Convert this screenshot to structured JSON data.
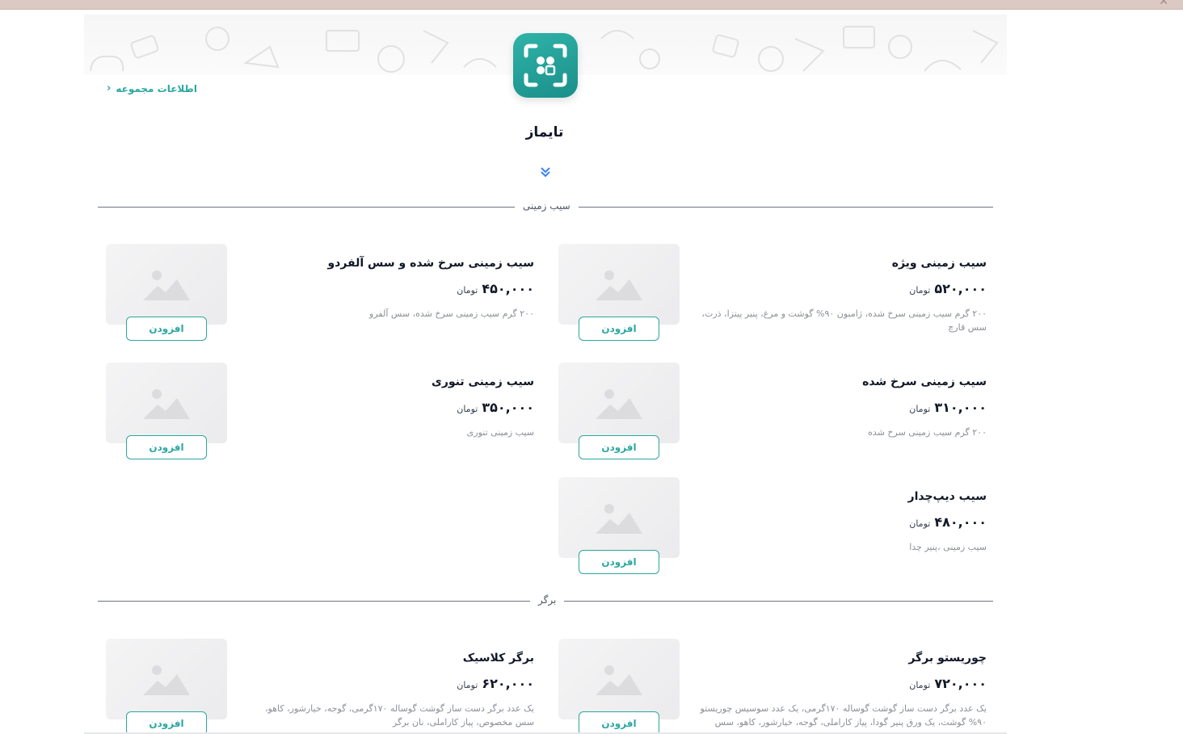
{
  "header": {
    "collection_info_link": "اطلاعات مجموعه",
    "restaurant_name": "تایماز"
  },
  "colors": {
    "accent": "#2ba7a0",
    "logo_gradient_start": "#2fb3a8",
    "logo_gradient_end": "#1b8f8a"
  },
  "sections": [
    {
      "title": "سیب زمینی",
      "items": [
        {
          "name": "سیب زمینی ویژه",
          "price": "۵۲۰,۰۰۰",
          "unit": "تومان",
          "desc": "۲۰۰ گرم سیب زمینی سرخ شده، ژامبون ۹۰% گوشت و مرغ، پنیر پیتزا، ذرت، سس قارچ",
          "button": "افزودن"
        },
        {
          "name": "سیب زمینی سرخ شده و سس آلفردو",
          "price": "۴۵۰,۰۰۰",
          "unit": "تومان",
          "desc": "۲۰۰ گرم سیب زمینی سرخ شده، سس آلفرو",
          "button": "افزودن"
        },
        {
          "name": "سیب زمینی سرخ شده",
          "price": "۳۱۰,۰۰۰",
          "unit": "تومان",
          "desc": "۲۰۰ گرم سیب زمینی سرخ شده",
          "button": "افزودن"
        },
        {
          "name": "سیب زمینی تنوری",
          "price": "۳۵۰,۰۰۰",
          "unit": "تومان",
          "desc": "سیب زمینی تنوری",
          "button": "افزودن"
        },
        {
          "name": "سیب دیپ‌چدار",
          "price": "۴۸۰,۰۰۰",
          "unit": "تومان",
          "desc": "سیب زمینی ،پنیر چدا",
          "button": "افزودن"
        }
      ]
    },
    {
      "title": "برگر",
      "items": [
        {
          "name": "چوریستو برگر",
          "price": "۷۲۰,۰۰۰",
          "unit": "تومان",
          "desc": "یک عدد برگر دست ساز گوشت گوساله ۱۷۰گرمی، یک عدد سوسیس چوریستو ۹۰% گوشت، یک ورق پنیر گودا، پیاز کاراملی، گوجه، خیارشور، کاهو، سس",
          "button": "افزودن"
        },
        {
          "name": "برگر کلاسیک",
          "price": "۶۲۰,۰۰۰",
          "unit": "تومان",
          "desc": "یک عدد برگر دست ساز گوشت گوساله ۱۷۰گرمی، گوجه، خیارشور، کاهو، سس مخصوص، پیاز کاراملی، نان برگر",
          "button": "افزودن"
        }
      ]
    }
  ]
}
